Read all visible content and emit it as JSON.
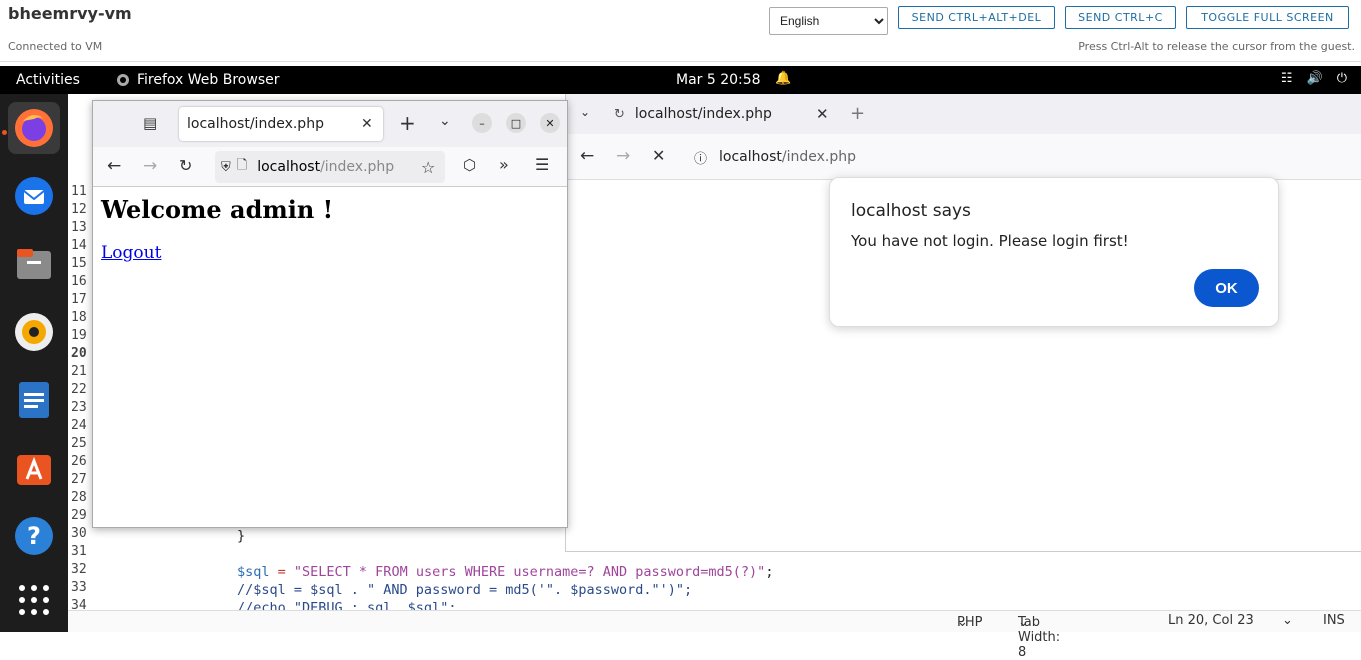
{
  "vm": {
    "name": "bheemrvy-vm",
    "status": "Connected to VM",
    "language": "English",
    "buttons": [
      "SEND CTRL+ALT+DEL",
      "SEND CTRL+C",
      "TOGGLE FULL SCREEN"
    ],
    "hint": "Press Ctrl-Alt to release the cursor from the guest."
  },
  "gnome": {
    "activities": "Activities",
    "app_name": "Firefox Web Browser",
    "clock": "Mar 5  20:58"
  },
  "dock": {
    "items": [
      "firefox-icon",
      "thunderbird-icon",
      "files-icon",
      "rhythmbox-icon",
      "writer-icon",
      "app-center-icon",
      "help-icon",
      "app-grid-icon"
    ]
  },
  "editor": {
    "line_numbers": [
      "11",
      "12",
      "13",
      "14",
      "15",
      "16",
      "17",
      "18",
      "19",
      "20",
      "21",
      "22",
      "23",
      "24",
      "25",
      "26",
      "27",
      "28",
      "29",
      "30",
      "31",
      "32",
      "33",
      "34"
    ],
    "brace": "}",
    "sql_line_var": "$sql",
    "sql_line_op": " = ",
    "sql_line_str": "\"SELECT * FROM users WHERE username=? AND password=md5(?)\"",
    "sql_line_end": ";",
    "comment_line": "//$sql = $sql . \" AND password = md5('\". $password.\"')\";",
    "partial_line": "//echo \"DEBUG : sql. $sql\";",
    "status": {
      "lang": "PHP",
      "tab_width": "Tab Width: 8",
      "position": "Ln 20, Col 23",
      "mode": "INS"
    }
  },
  "ff_right": {
    "tab_title": "localhost/index.php",
    "url_host": "localhost",
    "url_path": "/index.php"
  },
  "alert": {
    "title": "localhost says",
    "message": "You have not login. Please login first!",
    "ok": "OK"
  },
  "ff_left": {
    "tab_title": "localhost/index.php",
    "url_host": "localhost",
    "url_path": "/index.php",
    "heading": "Welcome admin !",
    "link": "Logout"
  }
}
